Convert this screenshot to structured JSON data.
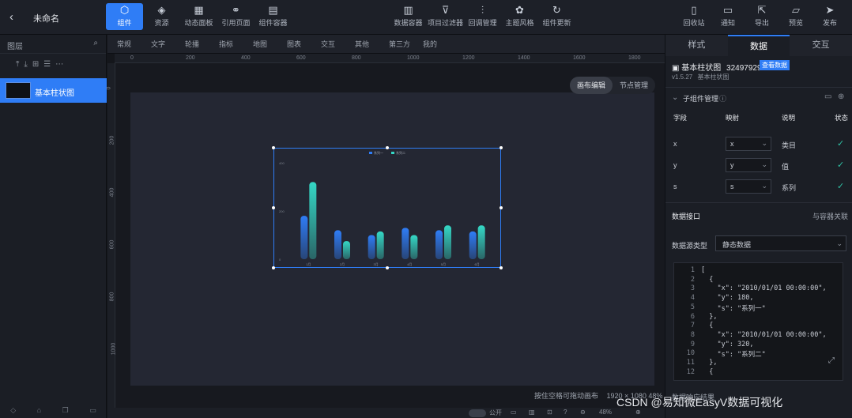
{
  "topbar": {
    "project_name": "未命名",
    "left_tools": [
      {
        "label": "组件",
        "icon": "hexagon-icon"
      },
      {
        "label": "资源",
        "icon": "layers-icon"
      },
      {
        "label": "动态面板",
        "icon": "panel-icon"
      },
      {
        "label": "引用页面",
        "icon": "link-icon"
      },
      {
        "label": "组件容器",
        "icon": "container-icon"
      }
    ],
    "center_tools": [
      {
        "label": "数据容器",
        "icon": "bar-chart-icon"
      },
      {
        "label": "项目过滤器",
        "icon": "filter-icon"
      },
      {
        "label": "回调管理",
        "icon": "sliders-icon"
      },
      {
        "label": "主题风格",
        "icon": "palette-icon"
      },
      {
        "label": "组件更新",
        "icon": "refresh-icon"
      }
    ],
    "right_tools": [
      {
        "label": "回收站",
        "icon": "trash-icon"
      },
      {
        "label": "通知",
        "icon": "message-icon"
      },
      {
        "label": "导出",
        "icon": "export-icon"
      },
      {
        "label": "预览",
        "icon": "preview-icon"
      },
      {
        "label": "发布",
        "icon": "send-icon"
      }
    ]
  },
  "left_panel": {
    "title": "图层",
    "layer_item": "基本柱状图"
  },
  "categories": [
    "常规",
    "文字",
    "轮播",
    "指标",
    "地图",
    "图表",
    "交互",
    "其他",
    "第三方",
    "我的"
  ],
  "ruler": {
    "h_ticks": [
      "0",
      "200",
      "400",
      "600",
      "800",
      "1000",
      "1200",
      "1400",
      "1600",
      "1800"
    ],
    "v_ticks": [
      "0",
      "200",
      "400",
      "600",
      "800",
      "1000"
    ]
  },
  "canvas": {
    "seg_on": "画布编辑",
    "seg_off": "节点管理",
    "status": "按住空格可拖动画布",
    "size": "1920 × 1080  48%",
    "zoom": "48%",
    "toggle_label": "公开"
  },
  "chart_data": {
    "type": "bar",
    "categories": [
      "1月",
      "2月",
      "3月",
      "4月",
      "5月",
      "6月"
    ],
    "series": [
      {
        "name": "系列一",
        "values": [
          180,
          120,
          100,
          130,
          120,
          115
        ]
      },
      {
        "name": "系列二",
        "values": [
          320,
          75,
          115,
          100,
          140,
          140
        ]
      }
    ],
    "ylim": [
      0,
      400
    ],
    "colors": [
      "#2f7df6",
      "#35d8c6"
    ]
  },
  "right_panel": {
    "tabs": [
      "样式",
      "数据",
      "交互"
    ],
    "component_name": "基本柱状图",
    "component_id": "32497929",
    "version_badge": "查看数据",
    "version": "v1.5.27",
    "desc": "基本柱状图",
    "sub_section": "子组件管理",
    "table_headers": [
      "字段",
      "映射",
      "说明",
      "状态"
    ],
    "rows": [
      {
        "field": "x",
        "map": "x",
        "desc": "类目"
      },
      {
        "field": "y",
        "map": "y",
        "desc": "值"
      },
      {
        "field": "s",
        "map": "s",
        "desc": "系列"
      }
    ],
    "data_api": "数据接口",
    "data_link": "与容器关联",
    "source_label": "数据源类型",
    "source_value": "静态数据",
    "code_lines": [
      {
        "n": "1",
        "t": "["
      },
      {
        "n": "2",
        "t": "  {"
      },
      {
        "n": "3",
        "t": "    \"x\": \"2010/01/01 00:00:00\","
      },
      {
        "n": "4",
        "t": "    \"y\": 180,"
      },
      {
        "n": "5",
        "t": "    \"s\": \"系列一\""
      },
      {
        "n": "6",
        "t": "  },"
      },
      {
        "n": "7",
        "t": "  {"
      },
      {
        "n": "8",
        "t": "    \"x\": \"2010/01/01 00:00:00\","
      },
      {
        "n": "9",
        "t": "    \"y\": 320,"
      },
      {
        "n": "10",
        "t": "    \"s\": \"系列二\""
      },
      {
        "n": "11",
        "t": "  },"
      },
      {
        "n": "12",
        "t": "  {"
      }
    ],
    "bottom_label": "数据响应结果",
    "watermark": "CSDN @易知微EasyV数据可视化"
  }
}
